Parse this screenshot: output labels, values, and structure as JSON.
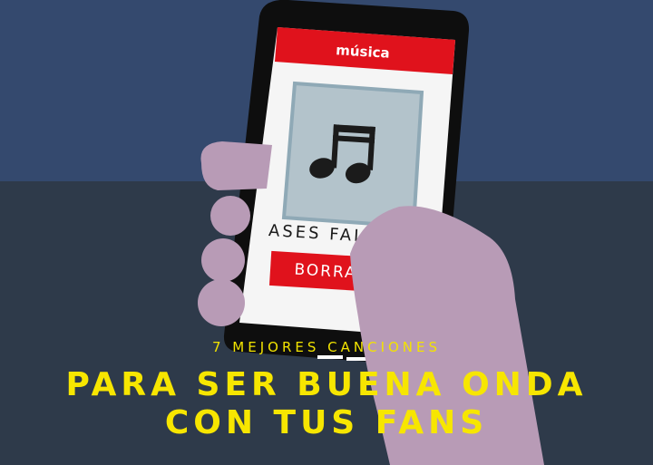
{
  "phone": {
    "app_header": "música",
    "track": {
      "title": "ASES FAL",
      "artwork_icon": "music-note-icon"
    },
    "delete_button_label": "BORRAR"
  },
  "headline": {
    "kicker": "7 MEJORES CANCIONES",
    "line1": "PARA SER BUENA ONDA",
    "line2": "CON TUS FANS"
  },
  "colors": {
    "top_background": "#34496e",
    "bottom_background": "#2e3a4a",
    "accent_red": "#e0121c",
    "headline_yellow": "#f7e600",
    "hand": "#b89bb6",
    "artwork": "#b3c3cb"
  }
}
